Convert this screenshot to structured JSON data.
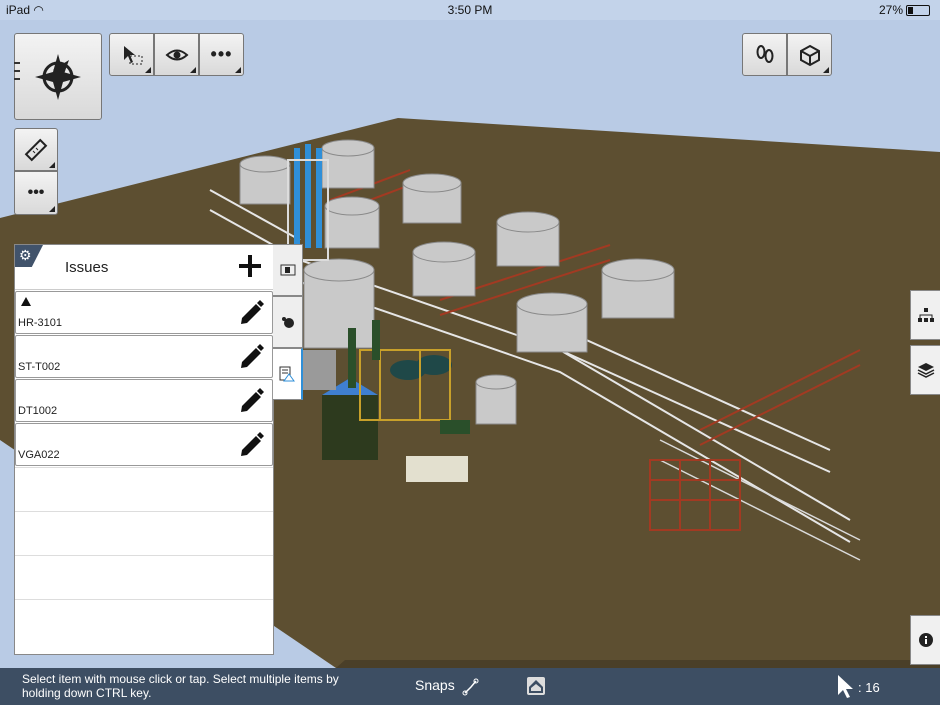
{
  "status_bar": {
    "device": "iPad",
    "time": "3:50 PM",
    "battery": "27%"
  },
  "toolbar": {
    "nav_icon": "compass-star-icon",
    "select_icon": "select-cursor-icon",
    "visibility_icon": "eye-icon",
    "more_icon": "more-dots-icon",
    "walk_icon": "footprints-icon",
    "view_cube_icon": "cube-icon",
    "measure_icon": "ruler-icon"
  },
  "issues_panel": {
    "title": "Issues",
    "items": [
      {
        "name": "HR-3101"
      },
      {
        "name": "ST-T002"
      },
      {
        "name": "DT1002"
      },
      {
        "name": "VGA022"
      }
    ]
  },
  "bottom_bar": {
    "hint": "Select item with mouse click or tap. Select multiple items by holding down CTRL key.",
    "snaps_label": "Snaps",
    "selection_count": ": 16"
  },
  "colors": {
    "sky": "#b9cbe5",
    "ground": "#5d4f31",
    "bar": "#3d4e63",
    "accent": "#2f8fd8"
  }
}
